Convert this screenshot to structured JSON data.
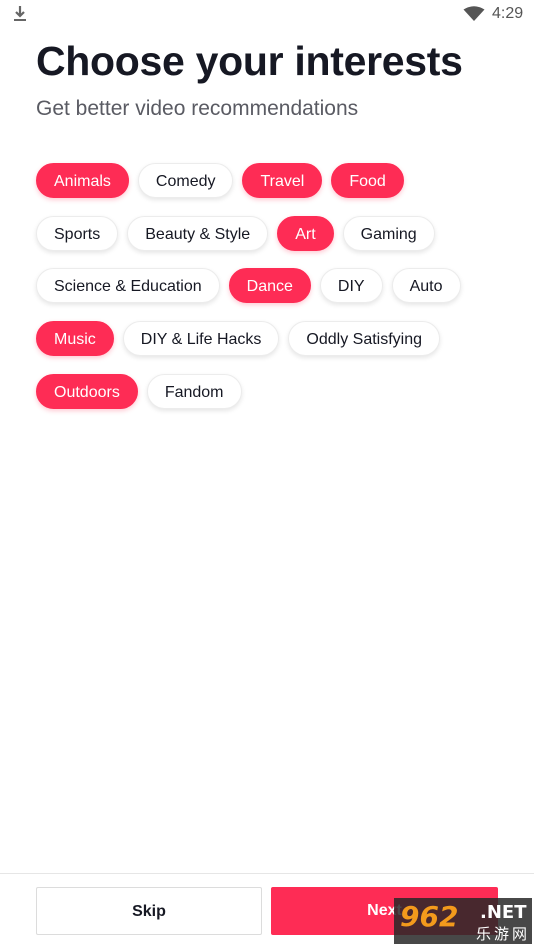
{
  "status_bar": {
    "time": "4:29",
    "icons": [
      "download-icon",
      "wifi-icon"
    ]
  },
  "header": {
    "title": "Choose your interests",
    "subtitle": "Get better video recommendations"
  },
  "colors": {
    "accent": "#fe2c55",
    "text": "#161823",
    "subtext": "#5a5b63"
  },
  "interests": [
    [
      {
        "label": "Animals",
        "selected": true
      },
      {
        "label": "Comedy",
        "selected": false
      },
      {
        "label": "Travel",
        "selected": true
      },
      {
        "label": "Food",
        "selected": true
      }
    ],
    [
      {
        "label": "Sports",
        "selected": false
      },
      {
        "label": "Beauty & Style",
        "selected": false
      },
      {
        "label": "Art",
        "selected": true
      },
      {
        "label": "Gaming",
        "selected": false
      }
    ],
    [
      {
        "label": "Science & Education",
        "selected": false
      },
      {
        "label": "Dance",
        "selected": true
      },
      {
        "label": "DIY",
        "selected": false
      },
      {
        "label": "Auto",
        "selected": false
      }
    ],
    [
      {
        "label": "Music",
        "selected": true
      },
      {
        "label": "DIY & Life Hacks",
        "selected": false
      },
      {
        "label": "Oddly Satisfying",
        "selected": false
      }
    ],
    [
      {
        "label": "Outdoors",
        "selected": true
      },
      {
        "label": "Fandom",
        "selected": false
      }
    ]
  ],
  "footer": {
    "skip_label": "Skip",
    "next_label": "Next"
  },
  "watermark": {
    "number": "962",
    "suffix": ".NET",
    "chinese": "乐游网"
  }
}
